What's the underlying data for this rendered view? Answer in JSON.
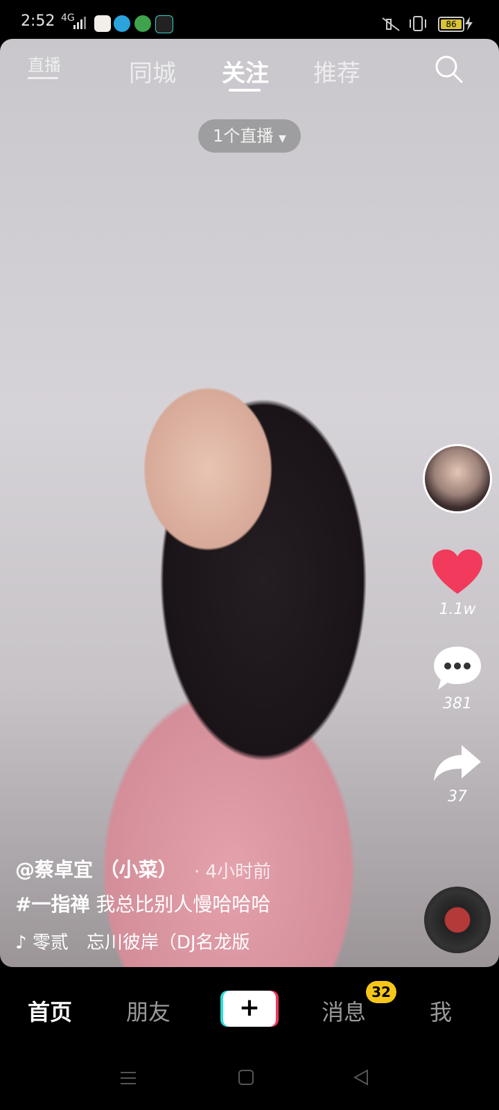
{
  "status_bar": {
    "time": "2:52",
    "network": "4G",
    "battery": "86",
    "apps": [
      "app-1",
      "telegram",
      "app-3",
      "app-4"
    ]
  },
  "top_nav": {
    "live_label": "直播",
    "tabs": [
      {
        "label": "同城",
        "active": false
      },
      {
        "label": "关注",
        "active": true
      },
      {
        "label": "推荐",
        "active": false
      }
    ],
    "live_pill": "1个直播",
    "search_icon": "search-icon"
  },
  "right_rail": {
    "likes": "1.1w",
    "comments": "381",
    "shares": "37"
  },
  "caption": {
    "author": "@蔡卓宜 （小菜）",
    "time_ago": "· 4小时前",
    "hashtag": "#一指禅",
    "text": "我总比别人慢哈哈哈",
    "music": "零贰　忘川彼岸（DJ名龙版"
  },
  "bottom_nav": {
    "items": [
      "首页",
      "朋友",
      "消息",
      "我"
    ],
    "message_badge": "32",
    "add_icon": "plus-icon"
  },
  "colors": {
    "like": "#f23a5c",
    "badge": "#f6c61b",
    "plus_cyan": "#2bd9d9",
    "plus_red": "#f0345a"
  }
}
